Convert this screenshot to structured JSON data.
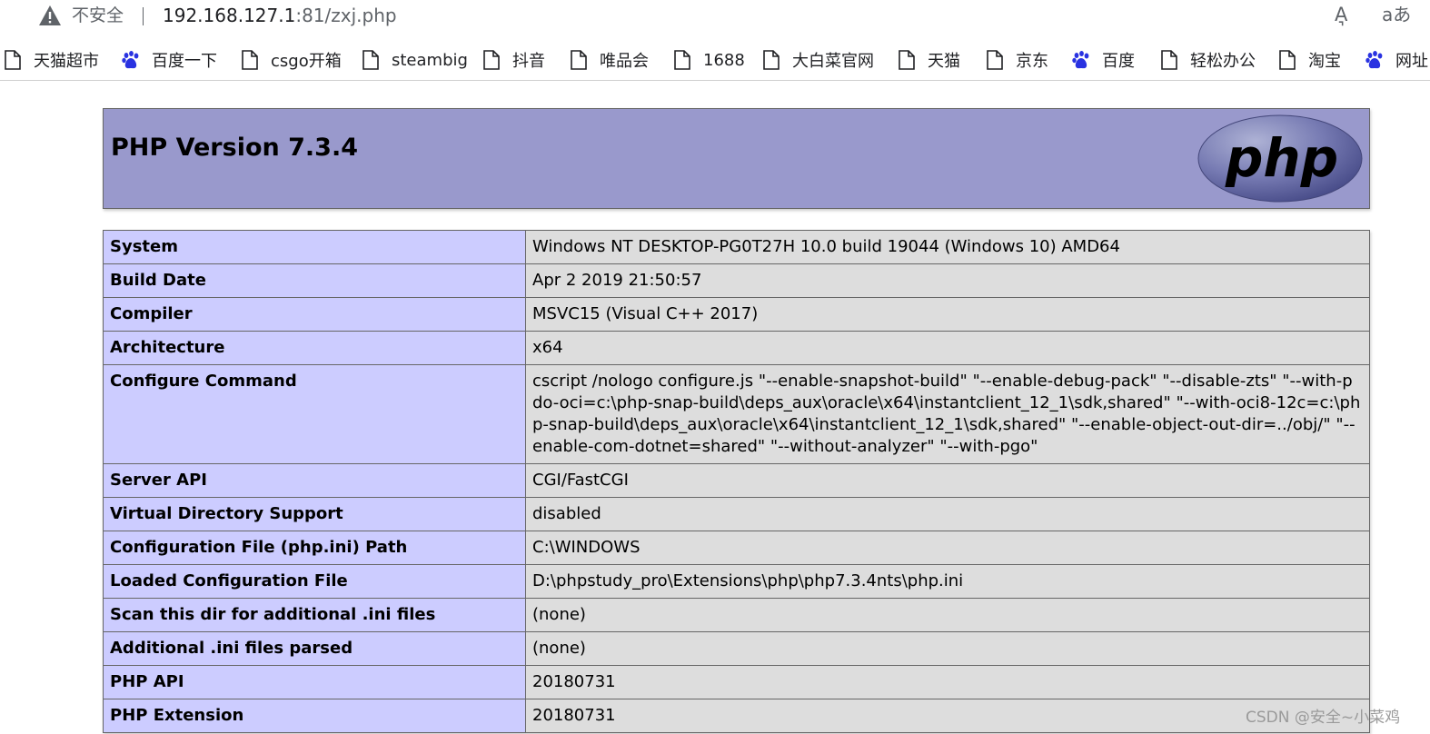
{
  "browser": {
    "security_label": "不安全",
    "url_host": "192.168.127.1",
    "url_rest": ":81/zxj.php",
    "read_aloud_glyph": "A͉",
    "translate_glyph": "aあ",
    "icons": {
      "warning": "warning-triangle-icon",
      "read_aloud": "read-aloud-icon",
      "translate": "translate-icon"
    },
    "bookmarks": [
      {
        "label": "天猫超市",
        "icon": "page-icon"
      },
      {
        "label": "百度一下",
        "icon": "baidu-paw-icon"
      },
      {
        "label": "csgo开箱",
        "icon": "page-icon"
      },
      {
        "label": "steambig",
        "icon": "page-icon"
      },
      {
        "label": "抖音",
        "icon": "page-icon"
      },
      {
        "label": "唯品会",
        "icon": "page-icon"
      },
      {
        "label": "1688",
        "icon": "page-icon"
      },
      {
        "label": "大白菜官网",
        "icon": "page-icon"
      },
      {
        "label": "天猫",
        "icon": "page-icon"
      },
      {
        "label": "京东",
        "icon": "page-icon"
      },
      {
        "label": "百度",
        "icon": "baidu-paw-icon"
      },
      {
        "label": "轻松办公",
        "icon": "page-icon"
      },
      {
        "label": "淘宝",
        "icon": "page-icon"
      },
      {
        "label": "网址",
        "icon": "baidu-paw-icon"
      }
    ]
  },
  "phpinfo": {
    "title": "PHP Version 7.3.4",
    "logo_text": "php",
    "rows": [
      {
        "key": "System",
        "value": "Windows NT DESKTOP-PG0T27H 10.0 build 19044 (Windows 10) AMD64"
      },
      {
        "key": "Build Date",
        "value": "Apr 2 2019 21:50:57"
      },
      {
        "key": "Compiler",
        "value": "MSVC15 (Visual C++ 2017)"
      },
      {
        "key": "Architecture",
        "value": "x64"
      },
      {
        "key": "Configure Command",
        "value": "cscript /nologo configure.js \"--enable-snapshot-build\" \"--enable-debug-pack\" \"--disable-zts\" \"--with-pdo-oci=c:\\php-snap-build\\deps_aux\\oracle\\x64\\instantclient_12_1\\sdk,shared\" \"--with-oci8-12c=c:\\php-snap-build\\deps_aux\\oracle\\x64\\instantclient_12_1\\sdk,shared\" \"--enable-object-out-dir=../obj/\" \"--enable-com-dotnet=shared\" \"--without-analyzer\" \"--with-pgo\""
      },
      {
        "key": "Server API",
        "value": "CGI/FastCGI"
      },
      {
        "key": "Virtual Directory Support",
        "value": "disabled"
      },
      {
        "key": "Configuration File (php.ini) Path",
        "value": "C:\\WINDOWS"
      },
      {
        "key": "Loaded Configuration File",
        "value": "D:\\phpstudy_pro\\Extensions\\php\\php7.3.4nts\\php.ini"
      },
      {
        "key": "Scan this dir for additional .ini files",
        "value": "(none)"
      },
      {
        "key": "Additional .ini files parsed",
        "value": "(none)"
      },
      {
        "key": "PHP API",
        "value": "20180731"
      },
      {
        "key": "PHP Extension",
        "value": "20180731"
      }
    ]
  },
  "watermark": "CSDN @安全~小菜鸡",
  "colors": {
    "header_bg": "#9999cc",
    "key_cell_bg": "#ccccff",
    "value_cell_bg": "#dddddd",
    "logo_purple": "#777bb3",
    "baidu_blue": "#2932e1"
  }
}
